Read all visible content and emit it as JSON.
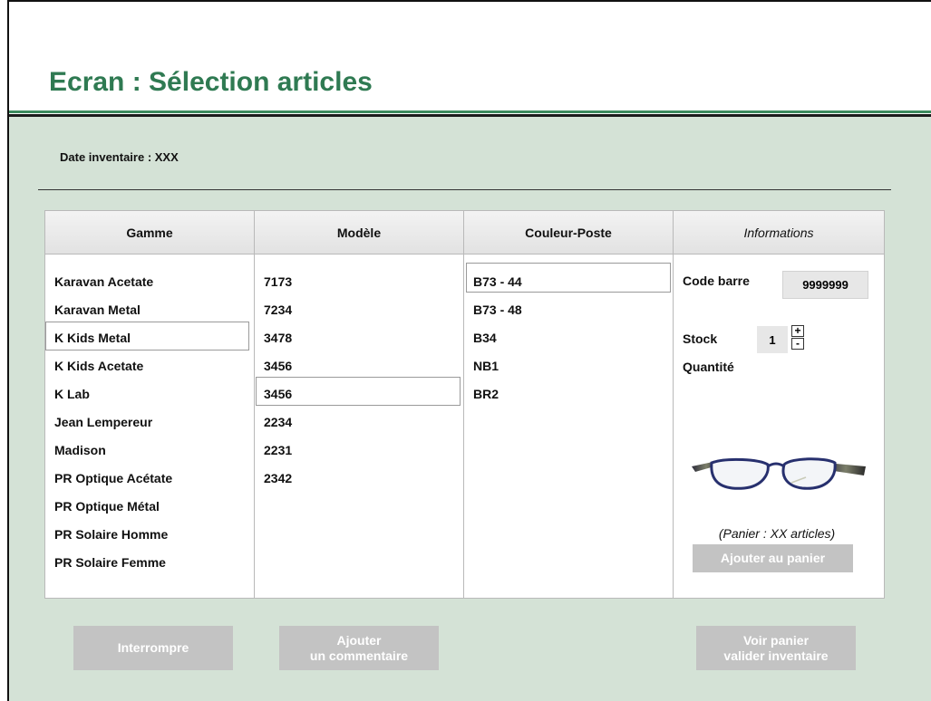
{
  "title": "Ecran : Sélection articles",
  "date_label": "Date inventaire : XXX",
  "columns": {
    "gamme": {
      "header": "Gamme",
      "items": [
        "Karavan Acetate",
        "Karavan Metal",
        "K Kids Metal",
        "K Kids Acetate",
        "K Lab",
        "Jean Lempereur",
        "Madison",
        "PR Optique Acétate",
        "PR Optique Métal",
        "PR Solaire Homme",
        "PR Solaire Femme"
      ],
      "selected_index": 2
    },
    "modele": {
      "header": "Modèle",
      "items": [
        "7173",
        "7234",
        "3478",
        "3456",
        "3456",
        "2234",
        "2231",
        "2342"
      ],
      "selected_index": 4
    },
    "couleur": {
      "header": "Couleur-Poste",
      "items": [
        "B73  - 44",
        "B73  - 48",
        " B34",
        "NB1",
        "BR2"
      ],
      "selected_index": 0
    },
    "informations": {
      "header": "Informations",
      "barcode_label": "Code barre",
      "barcode_value": "9999999",
      "stock_label": "Stock",
      "stock_value": "1",
      "plus": "+",
      "minus": "-",
      "quantity_label": "Quantité",
      "cart_note": "(Panier : XX articles)",
      "add_to_cart": "Ajouter au panier",
      "product_image": "eyeglasses-image"
    }
  },
  "buttons": {
    "interrupt": "Interrompre",
    "comment_line1": "Ajouter",
    "comment_line2": "un commentaire",
    "view_cart_line1": "Voir panier",
    "view_cart_line2": "valider inventaire"
  },
  "colors": {
    "title": "#2f7a52",
    "content_bg": "#d4e2d6",
    "button_bg": "#c3c3c3"
  }
}
